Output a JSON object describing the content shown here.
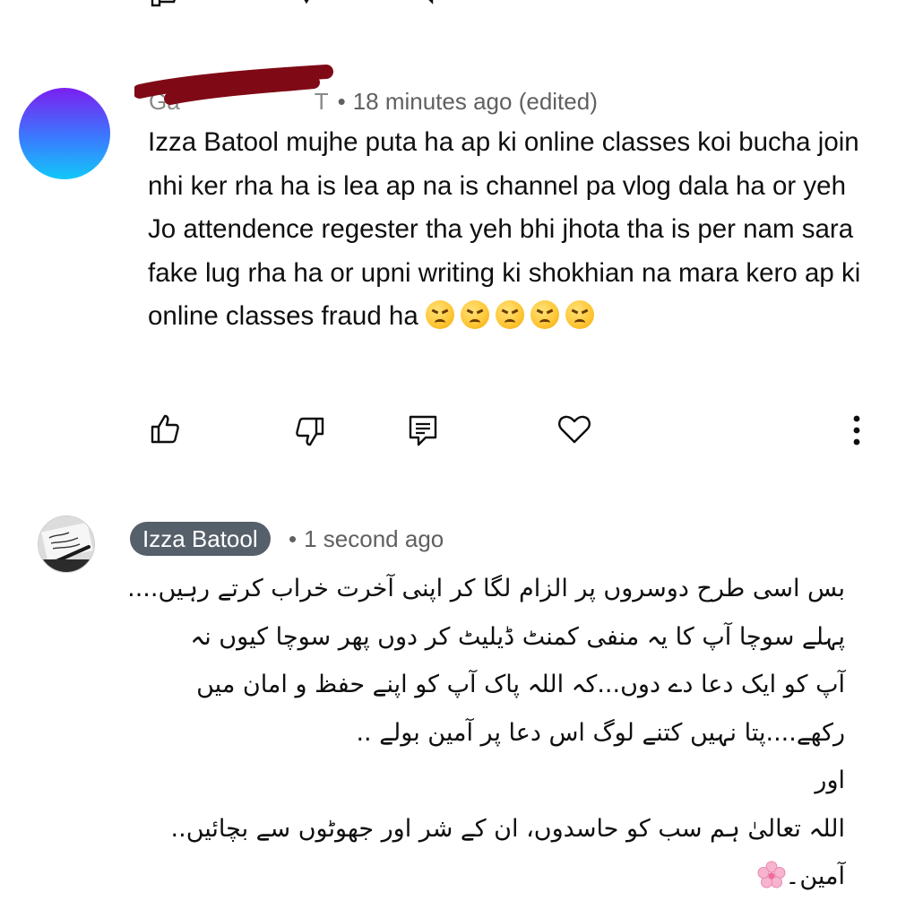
{
  "comment_1": {
    "author": "Ga",
    "author_suffix": "T",
    "time": "18 minutes ago (edited)",
    "body": "Izza Batool mujhe puta ha ap ki online classes koi bucha join nhi ker rha ha is lea ap na is channel pa vlog dala ha or yeh Jo attendence regester tha yeh bhi jhota tha is per nam sara fake lug rha ha or upni writing ki shokhian na mara kero ap ki online classes fraud ha",
    "emoji_icon": "angry-face-icon",
    "emoji_count": 5
  },
  "comment_2": {
    "author_chip": "Izza Batool",
    "time": "1 second ago",
    "lines": [
      "بس اسی طرح دوسروں پر الزام لگا کر اپنی آخرت خراب کرتے رہیں....",
      "پہلے سوچا آپ کا یہ منفی کمنٹ ڈیلیٹ کر دوں پھر سوچا کیوں نہ",
      "آپ کو ایک دعا دے دوں...کہ اللہ پاک آپ کو اپنے حفظ و امان میں",
      "رکھے....پتا نہیں کتنے لوگ اس دعا پر آمین بولے ..",
      "اور",
      "اللہ تعالیٰ ہم سب کو حاسدوں، ان کے شر اور جھوٹوں سے بچائیں..",
      "آمین۔"
    ],
    "flower_icon": "cherry-blossom-icon"
  },
  "separator": "•",
  "colors": {
    "avatar_gradient_top": "#7b1ff0",
    "avatar_gradient_bottom": "#12c8f8",
    "author_chip_bg": "#56606b",
    "redaction": "#7f0a16",
    "meta_text": "#606060"
  }
}
